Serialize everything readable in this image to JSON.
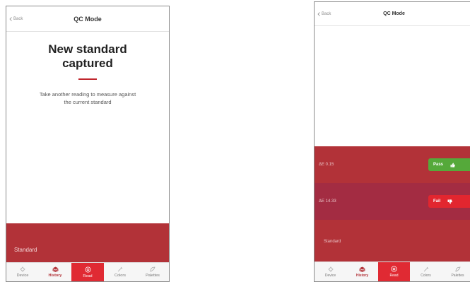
{
  "left": {
    "nav": {
      "back_label": "Back",
      "title": "QC Mode"
    },
    "heading_line1": "New standard",
    "heading_line2": "captured",
    "body_line1": "Take another reading to measure against",
    "body_line2": "the current standard",
    "band_label": "Standard"
  },
  "right": {
    "nav": {
      "back_label": "Back",
      "title": "QC Mode"
    },
    "rows": [
      {
        "label": "ΔE 0.15",
        "verdict": "Pass",
        "verdict_icon": "thumbs-up-icon"
      },
      {
        "label": "ΔE 14.33",
        "verdict": "Fail",
        "verdict_icon": "thumbs-down-icon"
      }
    ],
    "standard_label": "Standard"
  },
  "tabs": [
    {
      "label": "Device",
      "icon": "device-icon"
    },
    {
      "label": "History",
      "icon": "history-icon"
    },
    {
      "label": "Read",
      "icon": "read-icon"
    },
    {
      "label": "Colors",
      "icon": "colors-icon"
    },
    {
      "label": "Palettes",
      "icon": "palettes-icon"
    }
  ],
  "colors": {
    "brand_red": "#b23238",
    "selected_tab": "#e02a33",
    "fail_row": "#a32c42",
    "pass_green": "#55a93a",
    "fail_red": "#e2262f"
  }
}
